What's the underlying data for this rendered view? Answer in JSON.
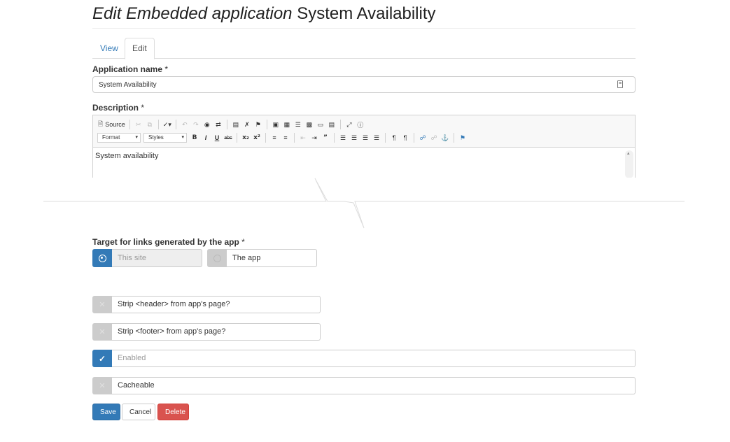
{
  "header": {
    "title_italic": "Edit Embedded application",
    "title_name": "System Availability"
  },
  "tabs": [
    {
      "label": "View",
      "active": false
    },
    {
      "label": "Edit",
      "active": true
    }
  ],
  "form": {
    "app_name": {
      "label": "Application name",
      "required": "*",
      "value": "System Availability"
    },
    "description": {
      "label": "Description",
      "required": "*",
      "source_label": "Source",
      "format_label": "Format",
      "styles_label": "Styles",
      "content": "System availability"
    },
    "link_target": {
      "label": "Target for links generated by the app",
      "required": "*",
      "options": [
        {
          "label": "This site",
          "selected": true
        },
        {
          "label": "The app",
          "selected": false
        }
      ]
    },
    "checkboxes": [
      {
        "label": "Strip <header> from app's page?",
        "checked": false
      },
      {
        "label": "Strip <footer> from app's page?",
        "checked": false
      },
      {
        "label": "Enabled",
        "checked": true
      },
      {
        "label": "Cacheable",
        "checked": false
      }
    ]
  },
  "buttons": {
    "save": "Save",
    "cancel": "Cancel",
    "delete": "Delete"
  },
  "colors": {
    "primary": "#337ab7",
    "danger": "#d9534f",
    "unchecked": "#cccccc"
  }
}
